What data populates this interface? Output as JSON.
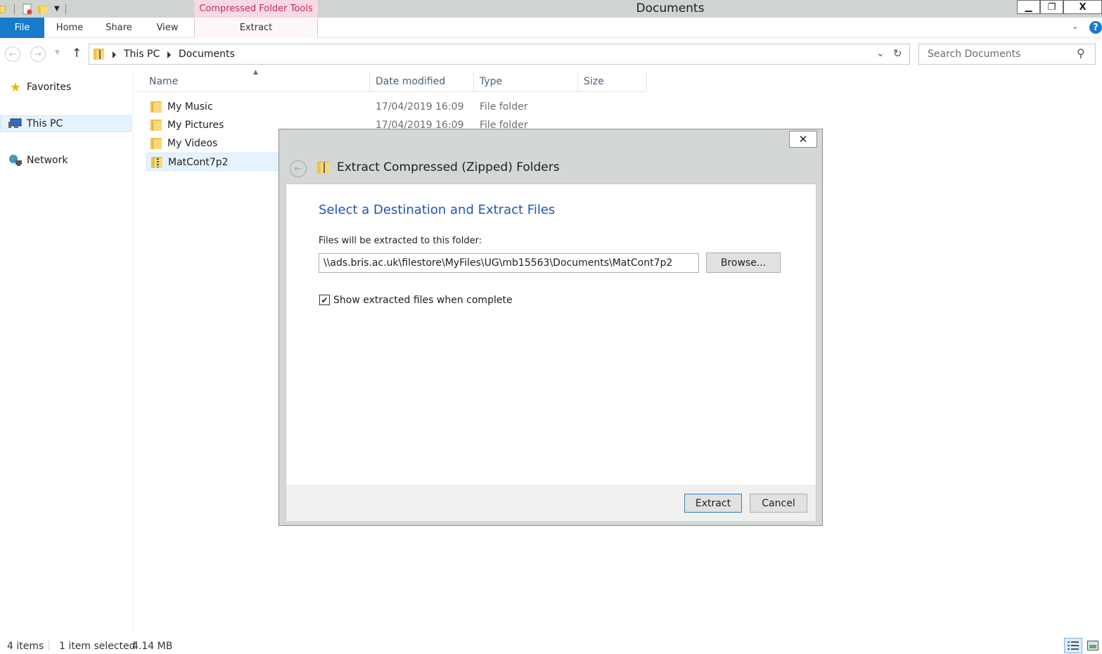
{
  "window": {
    "title": "Documents",
    "context_tab": "Compressed Folder Tools",
    "minimize_glyph": "▁",
    "restore_glyph": "❐",
    "close_glyph": "X"
  },
  "ribbon": {
    "tabs": [
      "File",
      "Home",
      "Share",
      "View",
      "Extract"
    ]
  },
  "address": {
    "crumbs": [
      "This PC",
      "Documents"
    ],
    "search_placeholder": "Search Documents"
  },
  "nav": {
    "items": [
      "Favorites",
      "This PC",
      "Network"
    ]
  },
  "columns": [
    "Name",
    "Date modified",
    "Type",
    "Size"
  ],
  "files": [
    {
      "name": "My Music",
      "date": "17/04/2019 16:09",
      "type": "File folder"
    },
    {
      "name": "My Pictures",
      "date": "17/04/2019 16:09",
      "type": "File folder"
    },
    {
      "name": "My Videos",
      "date": "",
      "type": ""
    },
    {
      "name": "MatCont7p2",
      "date": "",
      "type": ""
    }
  ],
  "status": {
    "item_count": "4 items",
    "selection": "1 item selected",
    "size": "4.14 MB"
  },
  "dialog": {
    "title": "Extract Compressed (Zipped) Folders",
    "close_glyph": "✕",
    "heading": "Select a Destination and Extract Files",
    "dest_label": "Files will be extracted to this folder:",
    "dest_value": "\\\\ads.bris.ac.uk\\filestore\\MyFiles\\UG\\mb15563\\Documents\\MatCont7p2",
    "browse_label": "Browse...",
    "checkbox_label": "Show extracted files when complete",
    "checkbox_checked": true,
    "extract_label": "Extract",
    "cancel_label": "Cancel"
  },
  "colors": {
    "file_tab": "#1979ca",
    "context_tab_bg": "#f6d9e4",
    "context_tab_text": "#c02c5c",
    "dialog_heading": "#1c57b4",
    "selected_row": "#e5f3ff"
  }
}
